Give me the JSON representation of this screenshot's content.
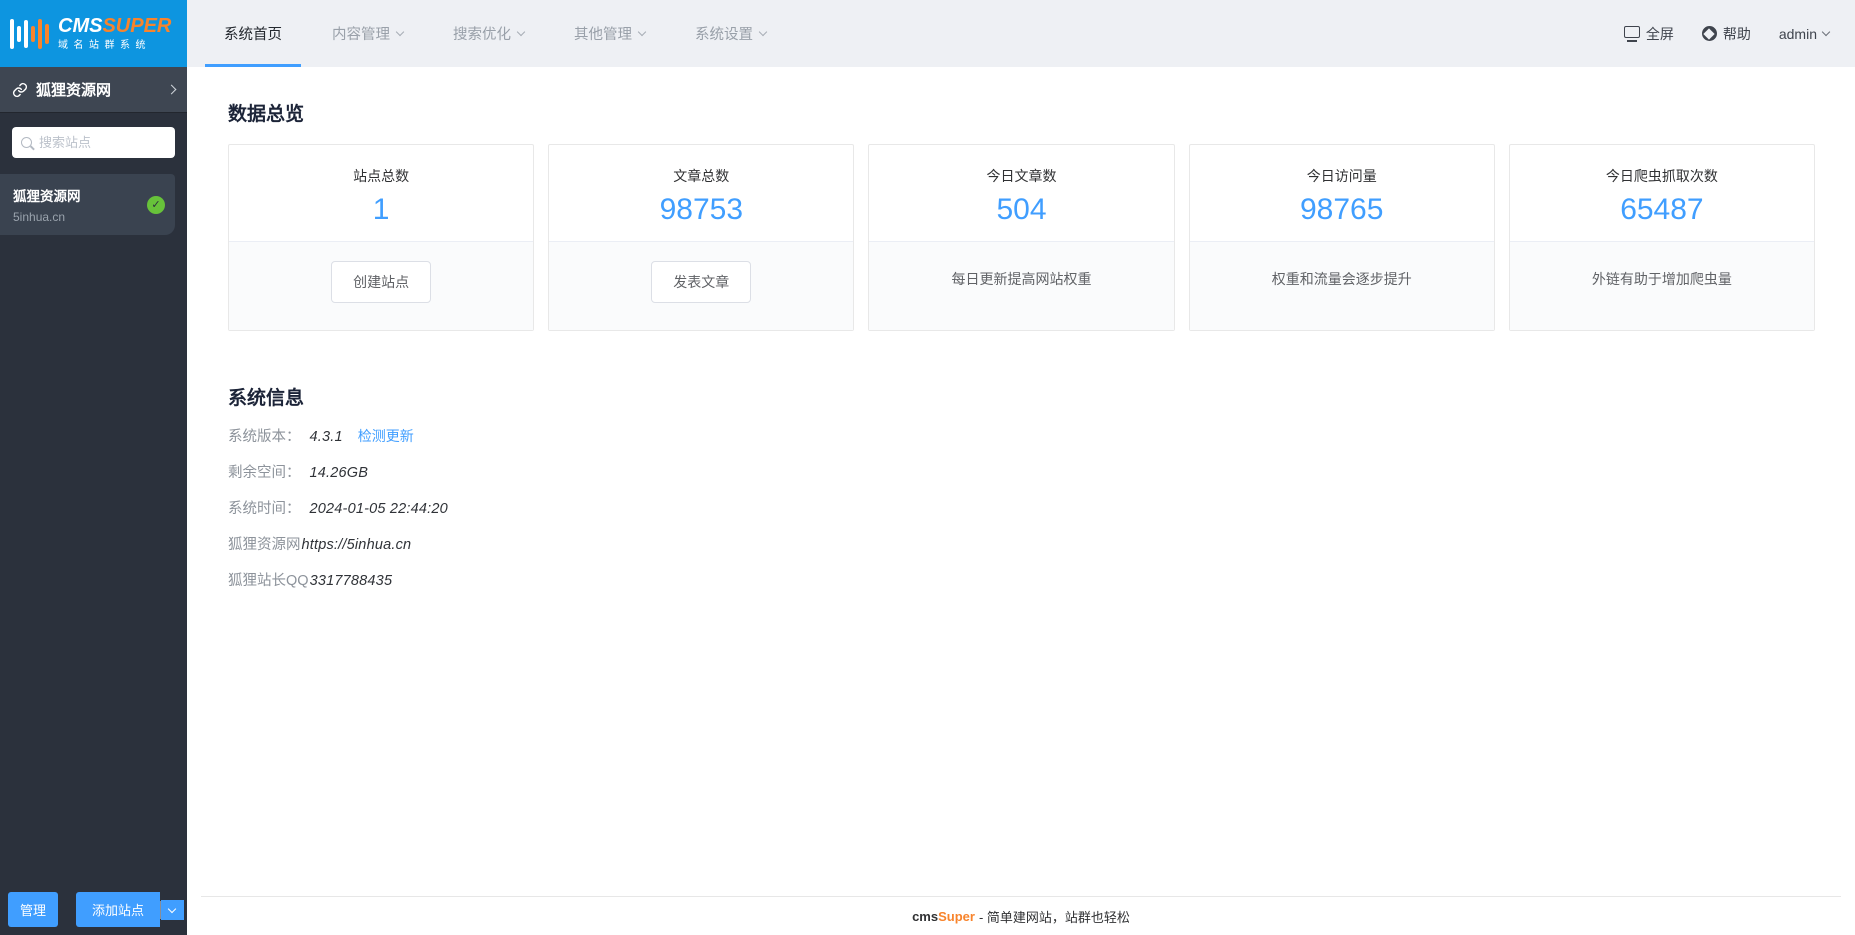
{
  "logo": {
    "cms": "CMS",
    "super": "SUPER",
    "subtitle": "域名站群系统"
  },
  "topnav": {
    "items": [
      {
        "label": "系统首页"
      },
      {
        "label": "内容管理"
      },
      {
        "label": "搜索优化"
      },
      {
        "label": "其他管理"
      },
      {
        "label": "系统设置"
      }
    ],
    "fullscreen_label": "全屏",
    "help_label": "帮助",
    "user": "admin"
  },
  "sidebar": {
    "site_name": "狐狸资源网",
    "search_placeholder": "搜索站点",
    "sites": [
      {
        "name": "狐狸资源网",
        "domain": "5inhua.cn",
        "status": "active"
      }
    ],
    "manage_label": "管理",
    "add_site_label": "添加站点"
  },
  "overview": {
    "title": "数据总览",
    "cards": [
      {
        "title": "站点总数",
        "value": "1",
        "action": "创建站点"
      },
      {
        "title": "文章总数",
        "value": "98753",
        "action": "发表文章"
      },
      {
        "title": "今日文章数",
        "value": "504",
        "note": "每日更新提高网站权重"
      },
      {
        "title": "今日访问量",
        "value": "98765",
        "note": "权重和流量会逐步提升"
      },
      {
        "title": "今日爬虫抓取次数",
        "value": "65487",
        "note": "外链有助于增加爬虫量"
      }
    ]
  },
  "system_info": {
    "title": "系统信息",
    "rows": [
      {
        "label": "系统版本：",
        "value": "4.3.1",
        "link": "检测更新"
      },
      {
        "label": "剩余空间：",
        "value": "14.26GB"
      },
      {
        "label": "系统时间：",
        "value": "2024-01-05 22:44:20"
      },
      {
        "label": "狐狸资源网",
        "value": "https://5inhua.cn"
      },
      {
        "label": "狐狸站长QQ",
        "value": "3317788435"
      }
    ]
  },
  "footer": {
    "brand_cms": "cms",
    "brand_super": "Super",
    "tagline": "- 简单建网站，站群也轻松"
  },
  "colors": {
    "accent": "#409eff",
    "logo_blue": "#0d95e0",
    "brand_orange": "#f8842c",
    "success_green": "#67c23a"
  }
}
